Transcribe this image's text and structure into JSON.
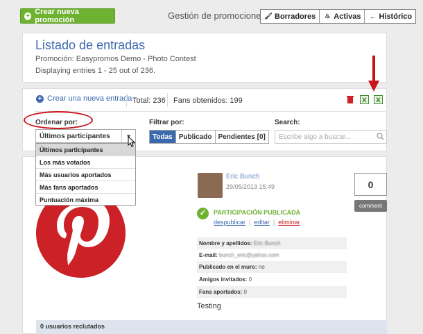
{
  "header": {
    "create_label": "Crear nueva promoción",
    "gestion": "Gestión de promociones",
    "tabs": [
      {
        "label": "Borradores",
        "icon": "brush-icon"
      },
      {
        "label": "Activas",
        "icon": "fire-icon"
      },
      {
        "label": "Histórico",
        "icon": "back-arrow-icon"
      }
    ]
  },
  "listing": {
    "title": "Listado de entradas",
    "promotion": "Promoción: Easypromos Demo - Photo Contest",
    "displaying": "Displaying entries 1 - 25 out of 236."
  },
  "toolbar": {
    "add_entry": "Crear una nueva entrada",
    "total": "Total: 236",
    "fans": "Fans obtenidos: 199"
  },
  "order": {
    "label": "Ordenar por:",
    "selected": "Últimos participantes",
    "options": [
      "Últimos participantes",
      "Los más votados",
      "Más usuarios aportados",
      "Más fans aportados",
      "Puntuación máxima"
    ]
  },
  "filter": {
    "label": "Filtrar por:",
    "options": [
      "Todas",
      "Publicado",
      "Pendientes [0]"
    ]
  },
  "search": {
    "label": "Search:",
    "placeholder": "Escribe algo a buscar..."
  },
  "entry": {
    "name": "Eric Bunch",
    "date": "29/05/2013 15:49",
    "votes": "0",
    "comment": "comment",
    "status": "PARTICIPACIÓN PUBLICADA",
    "actions": [
      "despublicar",
      "editar",
      "eliminar"
    ],
    "fields": [
      {
        "label": "Nombre y apellidos:",
        "value": "Eric Bunch"
      },
      {
        "label": "E-mail:",
        "value": "bunch_eric@yahoo.com"
      },
      {
        "label": "Publicado en el muro:",
        "value": "no"
      },
      {
        "label": "Amigos invitados:",
        "value": "0"
      },
      {
        "label": "Fans aportados:",
        "value": "0"
      }
    ],
    "text": "Testing"
  },
  "footer": {
    "recruited": "0 usuarios reclutados"
  },
  "colors": {
    "green": "#6fb232",
    "blue": "#3b69ad",
    "red": "#cc2127"
  }
}
